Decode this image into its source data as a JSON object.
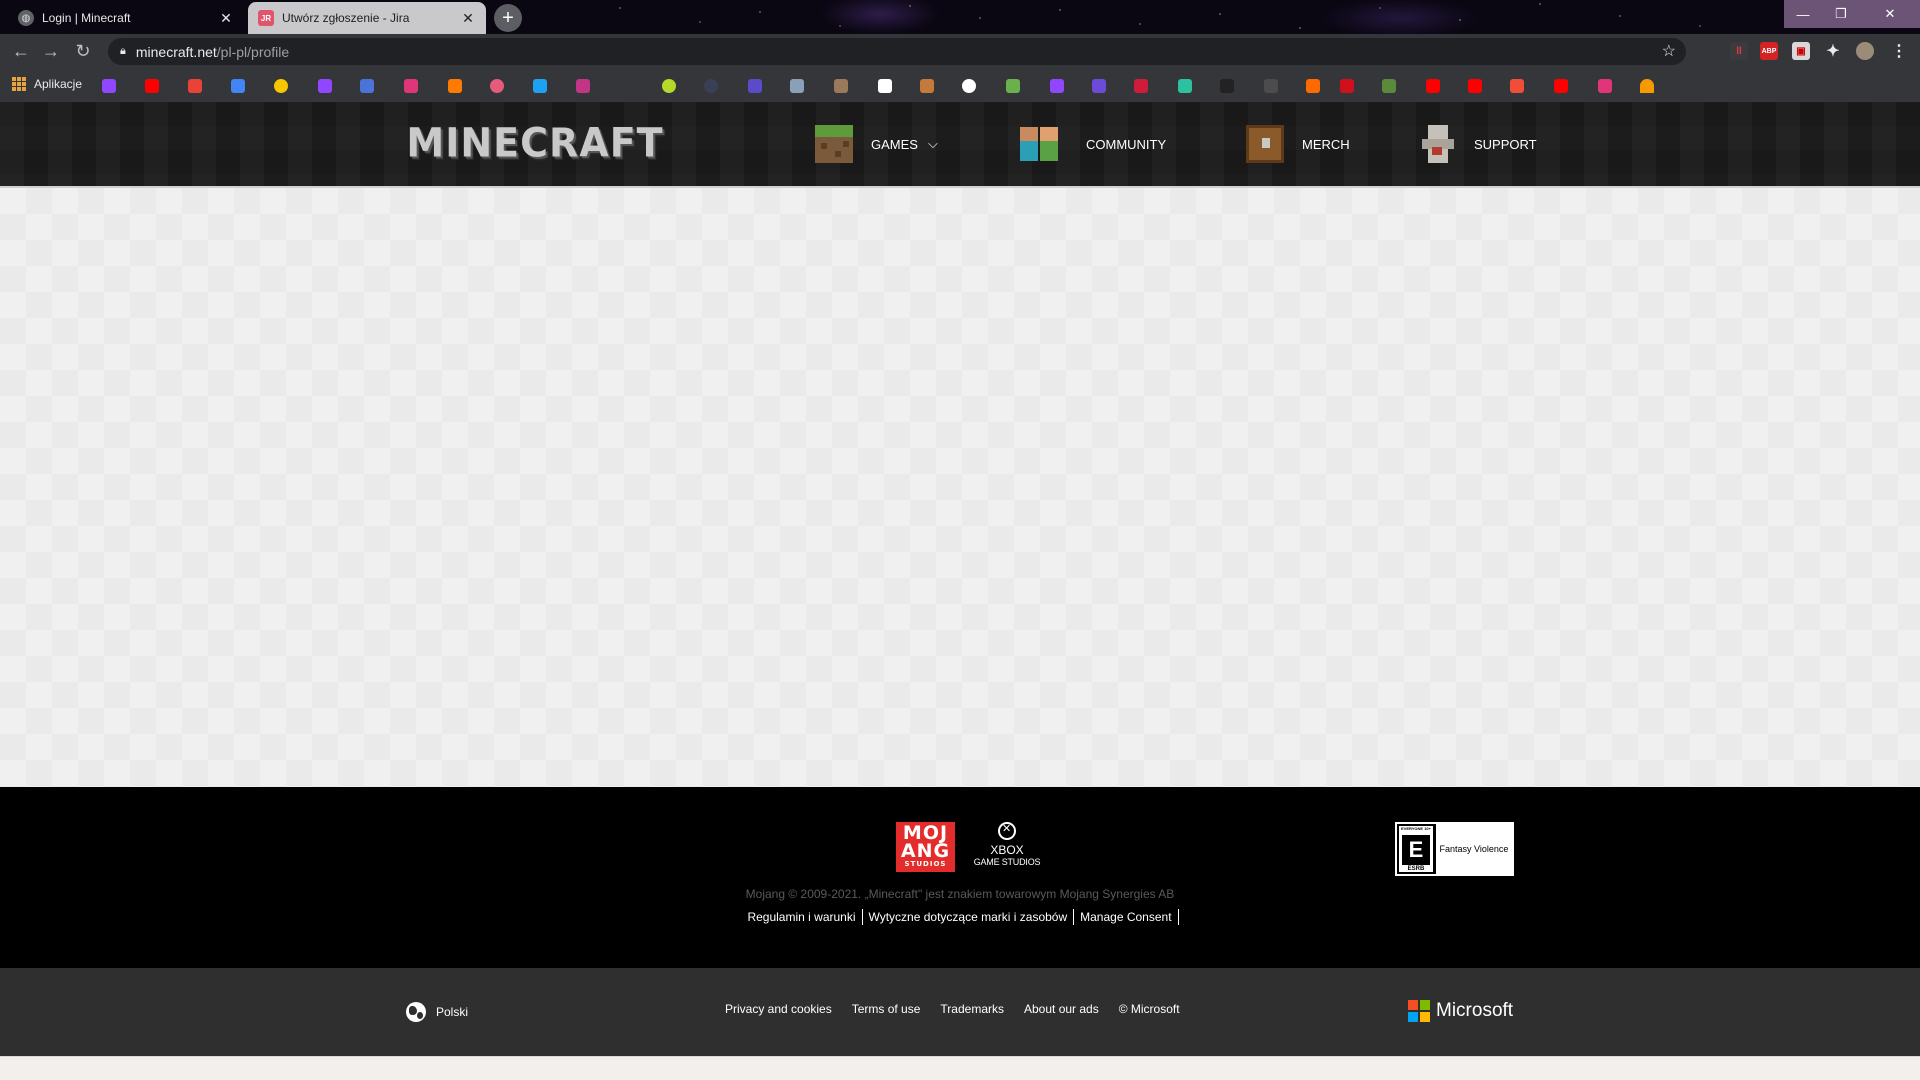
{
  "browser": {
    "tabs": [
      {
        "title": "Login | Minecraft",
        "favicon": "globe-icon",
        "active": false
      },
      {
        "title": "Utwórz zgłoszenie - Jira",
        "favicon": "jira-icon",
        "active": true
      }
    ],
    "url_host": "minecraft.net",
    "url_path": "/pl-pl/profile",
    "bookmarks_label": "Aplikacje"
  },
  "header": {
    "logo_text": "MINECRAFT",
    "nav": [
      {
        "label": "GAMES",
        "icon": "grass-block-icon",
        "has_dropdown": true
      },
      {
        "label": "COMMUNITY",
        "icon": "community-icon"
      },
      {
        "label": "MERCH",
        "icon": "chest-icon"
      },
      {
        "label": "SUPPORT",
        "icon": "iron-golem-icon"
      }
    ]
  },
  "footer": {
    "mojang_logo": {
      "line1": "MOJ",
      "line2": "ANG",
      "line3": "STUDIOS"
    },
    "xbox_logo": {
      "line1": "XBOX",
      "line2": "GAME STUDIOS"
    },
    "esrb": {
      "top": "EVERYONE 10+",
      "letter": "E",
      "label": "ESRB",
      "descriptor": "Fantasy Violence"
    },
    "copyright": "Mojang © 2009-2021. „Minecraft\" jest znakiem towarowym Mojang Synergies AB",
    "legal_links": [
      "Regulamin i warunki",
      "Wytyczne dotyczące marki i zasobów",
      "Manage Consent"
    ]
  },
  "ms_footer": {
    "language": "Polski",
    "links": [
      "Privacy and cookies",
      "Terms of use",
      "Trademarks",
      "About our ads",
      "© Microsoft"
    ],
    "brand": "Microsoft"
  },
  "colors": {
    "header_bg": "#1c1c1c",
    "main_bg": "#f0f0f0",
    "footer_bg": "#000000",
    "ms_footer_bg": "#2f2f2f",
    "mojang_red": "#e32d2d"
  }
}
